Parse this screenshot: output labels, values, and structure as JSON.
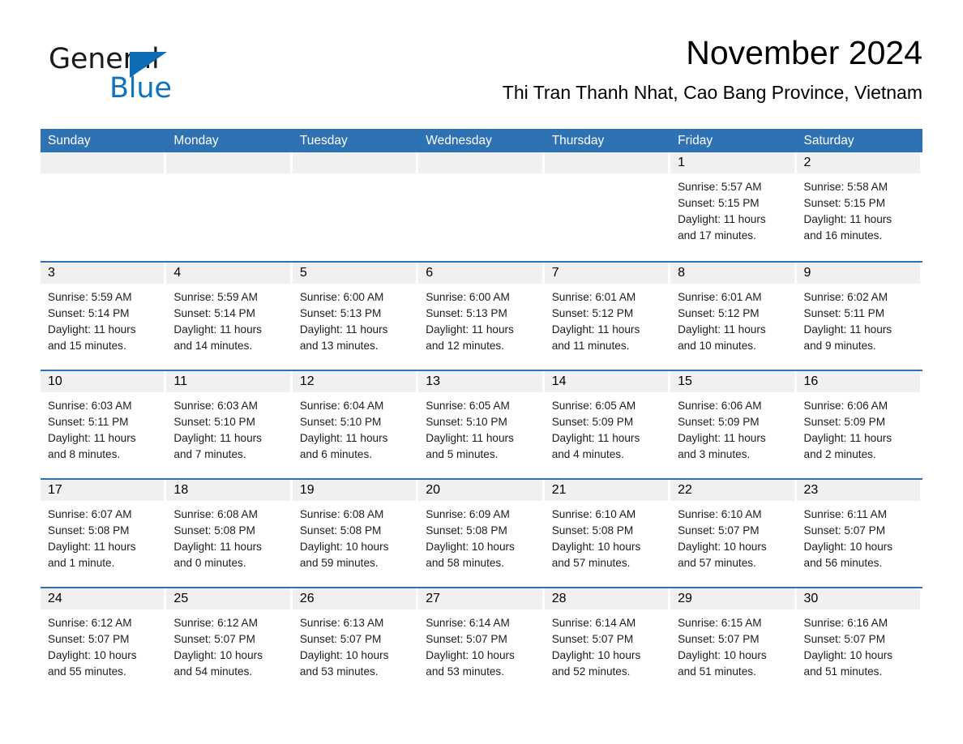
{
  "brand": {
    "name_part1": "General",
    "name_part2": "Blue",
    "triangle_color": "#0d6cb3",
    "blue_text_color": "#1273bd"
  },
  "header": {
    "month_title": "November 2024",
    "location": "Thi Tran Thanh Nhat, Cao Bang Province, Vietnam"
  },
  "calendar": {
    "header_color": "#2f72b4",
    "day_band_color": "#f0f0f0",
    "weekdays": [
      "Sunday",
      "Monday",
      "Tuesday",
      "Wednesday",
      "Thursday",
      "Friday",
      "Saturday"
    ],
    "weeks": [
      [
        {
          "day": "",
          "sunrise": "",
          "sunset": "",
          "daylight1": "",
          "daylight2": ""
        },
        {
          "day": "",
          "sunrise": "",
          "sunset": "",
          "daylight1": "",
          "daylight2": ""
        },
        {
          "day": "",
          "sunrise": "",
          "sunset": "",
          "daylight1": "",
          "daylight2": ""
        },
        {
          "day": "",
          "sunrise": "",
          "sunset": "",
          "daylight1": "",
          "daylight2": ""
        },
        {
          "day": "",
          "sunrise": "",
          "sunset": "",
          "daylight1": "",
          "daylight2": ""
        },
        {
          "day": "1",
          "sunrise": "Sunrise: 5:57 AM",
          "sunset": "Sunset: 5:15 PM",
          "daylight1": "Daylight: 11 hours",
          "daylight2": "and 17 minutes."
        },
        {
          "day": "2",
          "sunrise": "Sunrise: 5:58 AM",
          "sunset": "Sunset: 5:15 PM",
          "daylight1": "Daylight: 11 hours",
          "daylight2": "and 16 minutes."
        }
      ],
      [
        {
          "day": "3",
          "sunrise": "Sunrise: 5:59 AM",
          "sunset": "Sunset: 5:14 PM",
          "daylight1": "Daylight: 11 hours",
          "daylight2": "and 15 minutes."
        },
        {
          "day": "4",
          "sunrise": "Sunrise: 5:59 AM",
          "sunset": "Sunset: 5:14 PM",
          "daylight1": "Daylight: 11 hours",
          "daylight2": "and 14 minutes."
        },
        {
          "day": "5",
          "sunrise": "Sunrise: 6:00 AM",
          "sunset": "Sunset: 5:13 PM",
          "daylight1": "Daylight: 11 hours",
          "daylight2": "and 13 minutes."
        },
        {
          "day": "6",
          "sunrise": "Sunrise: 6:00 AM",
          "sunset": "Sunset: 5:13 PM",
          "daylight1": "Daylight: 11 hours",
          "daylight2": "and 12 minutes."
        },
        {
          "day": "7",
          "sunrise": "Sunrise: 6:01 AM",
          "sunset": "Sunset: 5:12 PM",
          "daylight1": "Daylight: 11 hours",
          "daylight2": "and 11 minutes."
        },
        {
          "day": "8",
          "sunrise": "Sunrise: 6:01 AM",
          "sunset": "Sunset: 5:12 PM",
          "daylight1": "Daylight: 11 hours",
          "daylight2": "and 10 minutes."
        },
        {
          "day": "9",
          "sunrise": "Sunrise: 6:02 AM",
          "sunset": "Sunset: 5:11 PM",
          "daylight1": "Daylight: 11 hours",
          "daylight2": "and 9 minutes."
        }
      ],
      [
        {
          "day": "10",
          "sunrise": "Sunrise: 6:03 AM",
          "sunset": "Sunset: 5:11 PM",
          "daylight1": "Daylight: 11 hours",
          "daylight2": "and 8 minutes."
        },
        {
          "day": "11",
          "sunrise": "Sunrise: 6:03 AM",
          "sunset": "Sunset: 5:10 PM",
          "daylight1": "Daylight: 11 hours",
          "daylight2": "and 7 minutes."
        },
        {
          "day": "12",
          "sunrise": "Sunrise: 6:04 AM",
          "sunset": "Sunset: 5:10 PM",
          "daylight1": "Daylight: 11 hours",
          "daylight2": "and 6 minutes."
        },
        {
          "day": "13",
          "sunrise": "Sunrise: 6:05 AM",
          "sunset": "Sunset: 5:10 PM",
          "daylight1": "Daylight: 11 hours",
          "daylight2": "and 5 minutes."
        },
        {
          "day": "14",
          "sunrise": "Sunrise: 6:05 AM",
          "sunset": "Sunset: 5:09 PM",
          "daylight1": "Daylight: 11 hours",
          "daylight2": "and 4 minutes."
        },
        {
          "day": "15",
          "sunrise": "Sunrise: 6:06 AM",
          "sunset": "Sunset: 5:09 PM",
          "daylight1": "Daylight: 11 hours",
          "daylight2": "and 3 minutes."
        },
        {
          "day": "16",
          "sunrise": "Sunrise: 6:06 AM",
          "sunset": "Sunset: 5:09 PM",
          "daylight1": "Daylight: 11 hours",
          "daylight2": "and 2 minutes."
        }
      ],
      [
        {
          "day": "17",
          "sunrise": "Sunrise: 6:07 AM",
          "sunset": "Sunset: 5:08 PM",
          "daylight1": "Daylight: 11 hours",
          "daylight2": "and 1 minute."
        },
        {
          "day": "18",
          "sunrise": "Sunrise: 6:08 AM",
          "sunset": "Sunset: 5:08 PM",
          "daylight1": "Daylight: 11 hours",
          "daylight2": "and 0 minutes."
        },
        {
          "day": "19",
          "sunrise": "Sunrise: 6:08 AM",
          "sunset": "Sunset: 5:08 PM",
          "daylight1": "Daylight: 10 hours",
          "daylight2": "and 59 minutes."
        },
        {
          "day": "20",
          "sunrise": "Sunrise: 6:09 AM",
          "sunset": "Sunset: 5:08 PM",
          "daylight1": "Daylight: 10 hours",
          "daylight2": "and 58 minutes."
        },
        {
          "day": "21",
          "sunrise": "Sunrise: 6:10 AM",
          "sunset": "Sunset: 5:08 PM",
          "daylight1": "Daylight: 10 hours",
          "daylight2": "and 57 minutes."
        },
        {
          "day": "22",
          "sunrise": "Sunrise: 6:10 AM",
          "sunset": "Sunset: 5:07 PM",
          "daylight1": "Daylight: 10 hours",
          "daylight2": "and 57 minutes."
        },
        {
          "day": "23",
          "sunrise": "Sunrise: 6:11 AM",
          "sunset": "Sunset: 5:07 PM",
          "daylight1": "Daylight: 10 hours",
          "daylight2": "and 56 minutes."
        }
      ],
      [
        {
          "day": "24",
          "sunrise": "Sunrise: 6:12 AM",
          "sunset": "Sunset: 5:07 PM",
          "daylight1": "Daylight: 10 hours",
          "daylight2": "and 55 minutes."
        },
        {
          "day": "25",
          "sunrise": "Sunrise: 6:12 AM",
          "sunset": "Sunset: 5:07 PM",
          "daylight1": "Daylight: 10 hours",
          "daylight2": "and 54 minutes."
        },
        {
          "day": "26",
          "sunrise": "Sunrise: 6:13 AM",
          "sunset": "Sunset: 5:07 PM",
          "daylight1": "Daylight: 10 hours",
          "daylight2": "and 53 minutes."
        },
        {
          "day": "27",
          "sunrise": "Sunrise: 6:14 AM",
          "sunset": "Sunset: 5:07 PM",
          "daylight1": "Daylight: 10 hours",
          "daylight2": "and 53 minutes."
        },
        {
          "day": "28",
          "sunrise": "Sunrise: 6:14 AM",
          "sunset": "Sunset: 5:07 PM",
          "daylight1": "Daylight: 10 hours",
          "daylight2": "and 52 minutes."
        },
        {
          "day": "29",
          "sunrise": "Sunrise: 6:15 AM",
          "sunset": "Sunset: 5:07 PM",
          "daylight1": "Daylight: 10 hours",
          "daylight2": "and 51 minutes."
        },
        {
          "day": "30",
          "sunrise": "Sunrise: 6:16 AM",
          "sunset": "Sunset: 5:07 PM",
          "daylight1": "Daylight: 10 hours",
          "daylight2": "and 51 minutes."
        }
      ]
    ]
  }
}
